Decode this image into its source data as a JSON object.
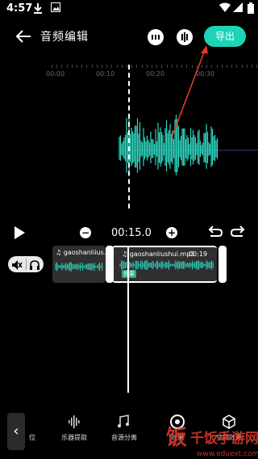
{
  "status_bar": {
    "time": "4:57",
    "icons": [
      "download-icon",
      "image-icon",
      "wifi-icon",
      "signal-icon",
      "battery-icon"
    ]
  },
  "header": {
    "title": "音频编辑",
    "export_label": "导出"
  },
  "ruler": {
    "labels": [
      "00:00",
      "00:10",
      "00:20",
      "00:30"
    ]
  },
  "controls": {
    "timecode": "00:15.0"
  },
  "track": {
    "clip1_name": "gaoshanliius...",
    "clip2_name": "gaoshanliushui.mp3",
    "clip2_duration": "00:19",
    "clip2_badge": "效果"
  },
  "toolbar": {
    "partial_label": "位",
    "items": [
      {
        "label": "乐器提取",
        "icon": "instrument-extract-icon"
      },
      {
        "label": "音源分离",
        "icon": "source-separation-icon"
      },
      {
        "label": "效果",
        "icon": "effect-icon"
      },
      {
        "label": "空间效果",
        "icon": "space-effect-icon"
      }
    ]
  },
  "watermark": {
    "logo_text": "千饭手游网",
    "url": "www.eduext.com"
  },
  "colors": {
    "accent": "#1ed3b6",
    "wave": "#2fd6c0",
    "annotation": "#e23a2a"
  }
}
